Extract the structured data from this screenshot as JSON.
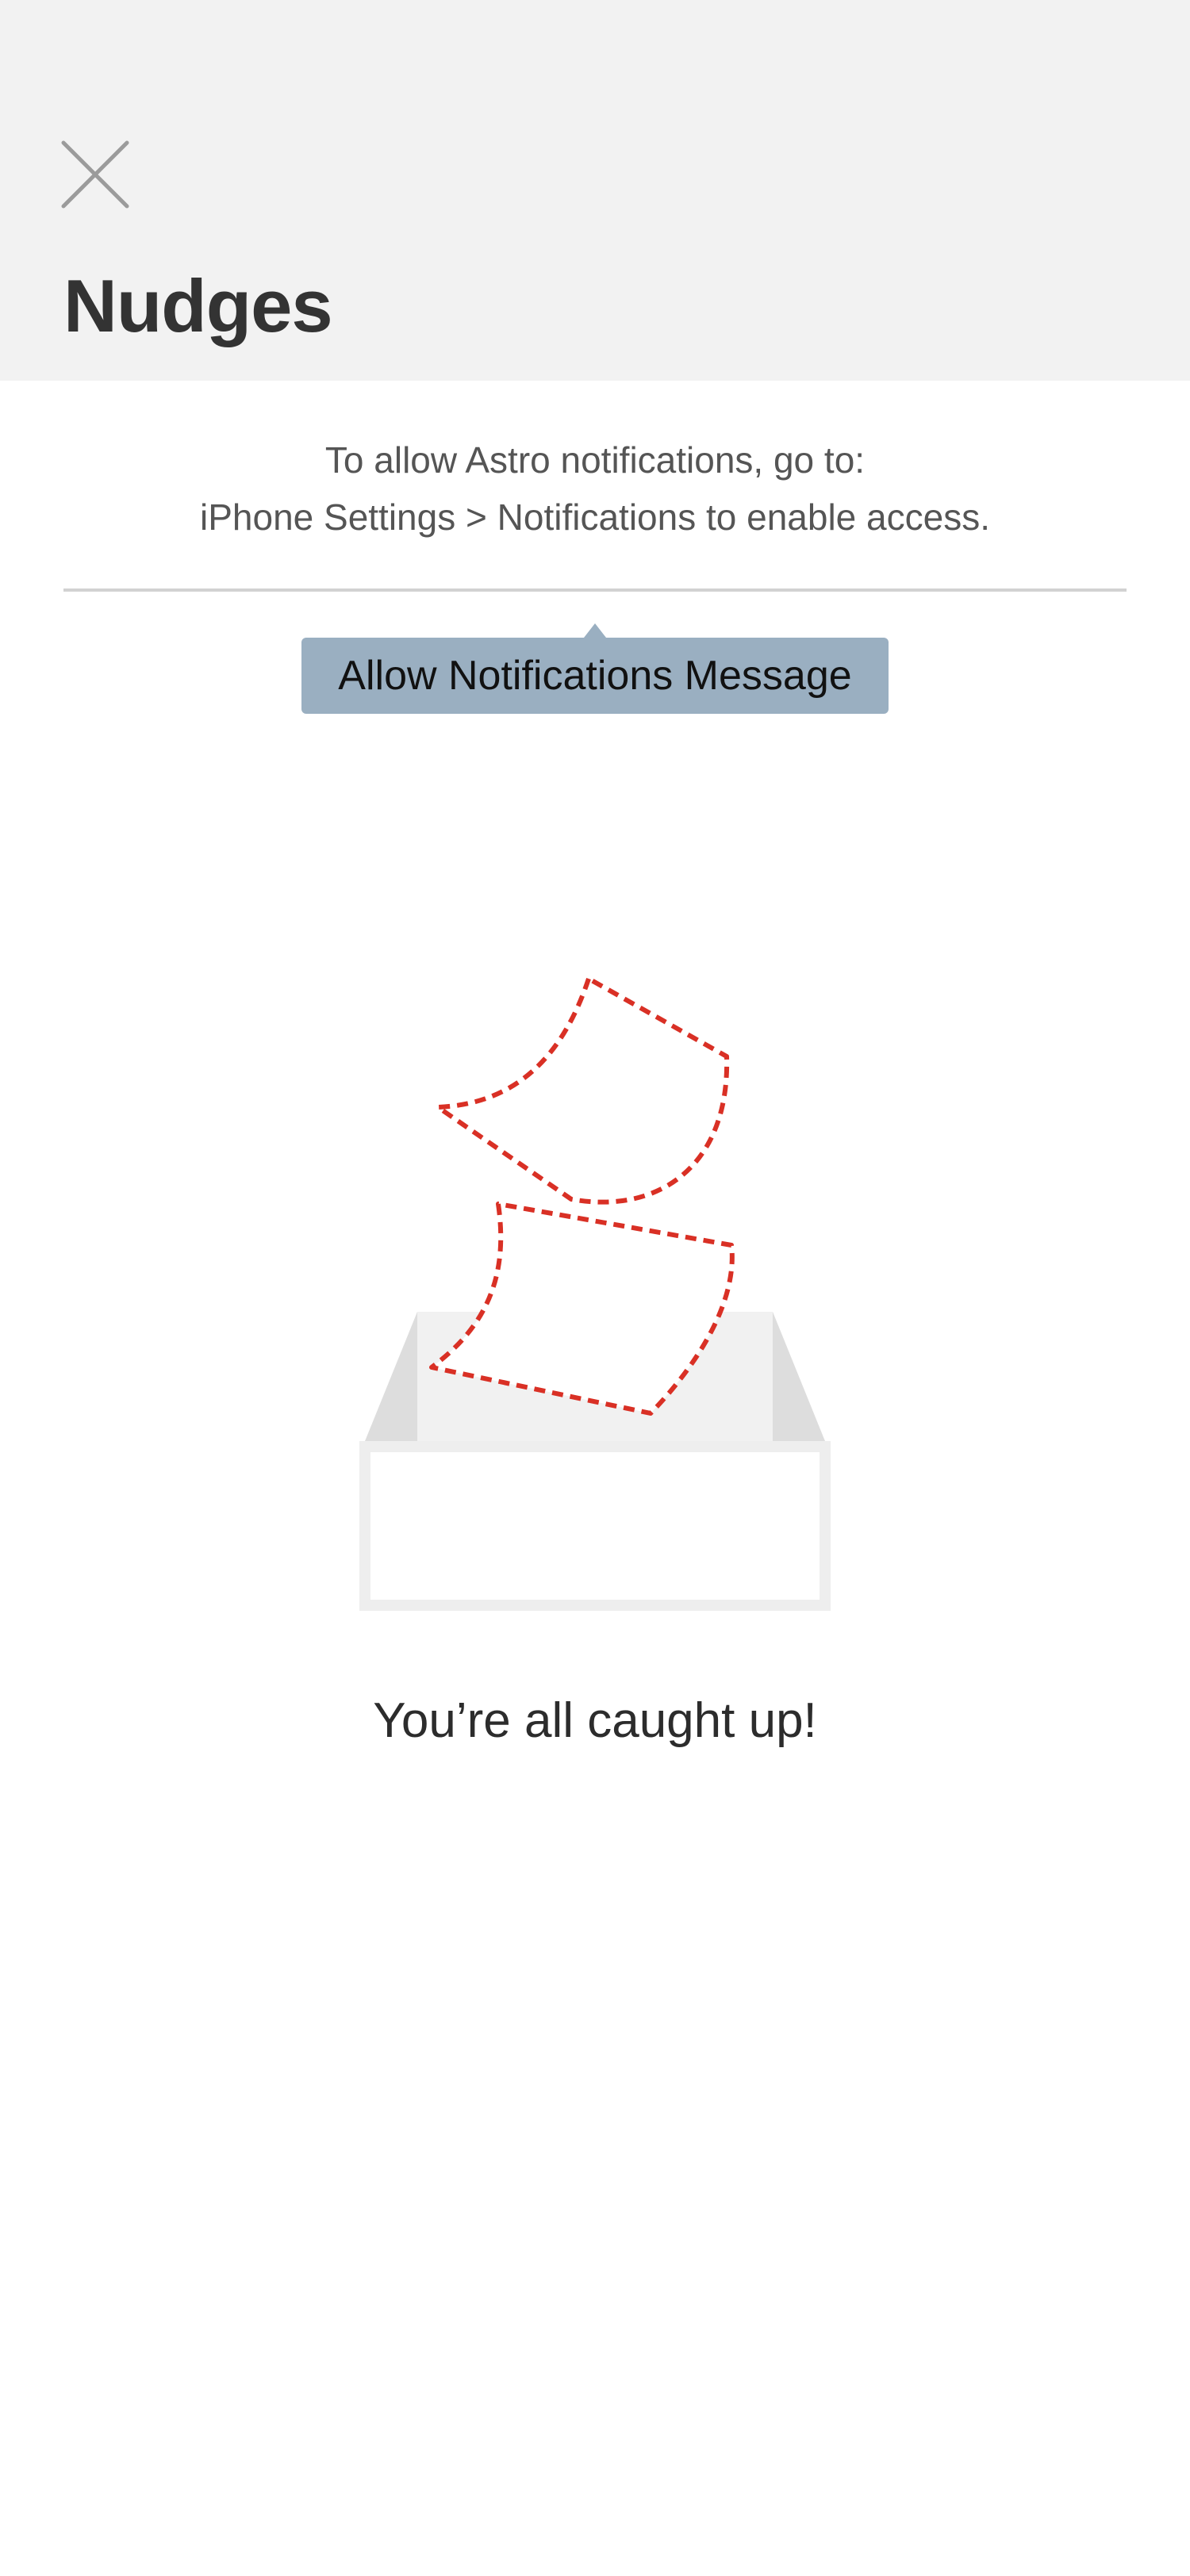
{
  "header": {
    "close_icon": "close-icon",
    "title": "Nudges"
  },
  "notice": {
    "line1": "To allow Astro notifications, go to:",
    "line2": "iPhone Settings > Notifications to enable access."
  },
  "tooltip": {
    "label": "Allow Notifications Message"
  },
  "empty_state": {
    "illustration_icon": "empty-inbox-icon",
    "message": "You’re all caught up!"
  },
  "colors": {
    "header_bg": "#f2f2f2",
    "tooltip_bg": "#9aafc1",
    "dashed_paper": "#d93025",
    "tray_gray": "#dddddd"
  }
}
